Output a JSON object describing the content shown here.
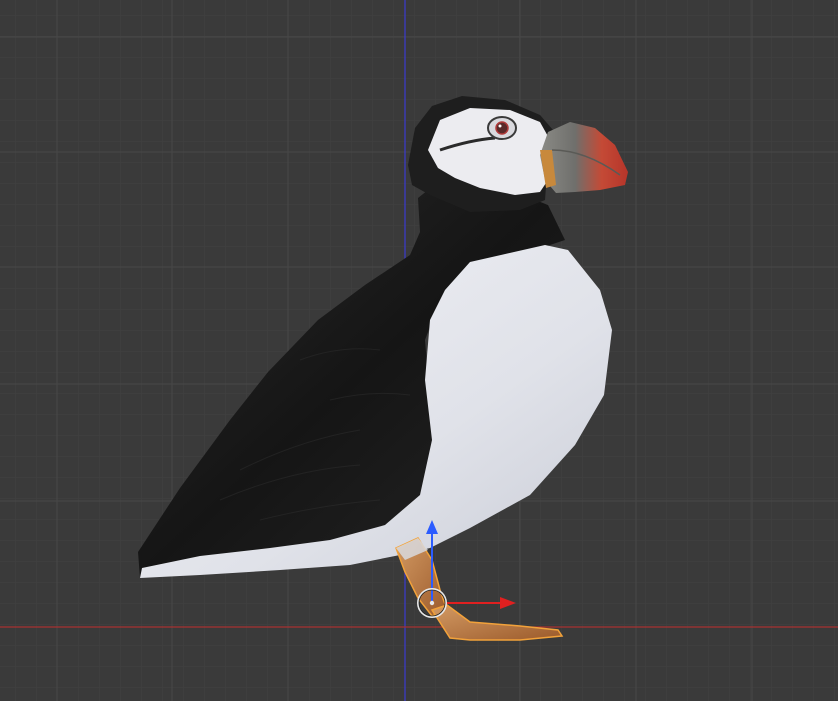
{
  "viewport": {
    "background": "#3a3a3a",
    "grid_minor": "#414141",
    "grid_major": "#474747",
    "z_axis_color": "#3a3ad0",
    "y_axis_color": "#b03030"
  },
  "model": {
    "subject": "puffin",
    "colors": {
      "black_plumage": "#1c1c1c",
      "white_plumage": "#e6e8ee",
      "beak_red": "#c8452e",
      "beak_gray": "#8a8a86",
      "eye_ring": "#b03a3a",
      "selected_leg": "#c07a40",
      "selection_outline": "#f2a23a"
    }
  },
  "gizmo": {
    "up_arrow_color": "#2b5cff",
    "right_arrow_color": "#e02020",
    "pivot_color": "#e8e8e8"
  }
}
